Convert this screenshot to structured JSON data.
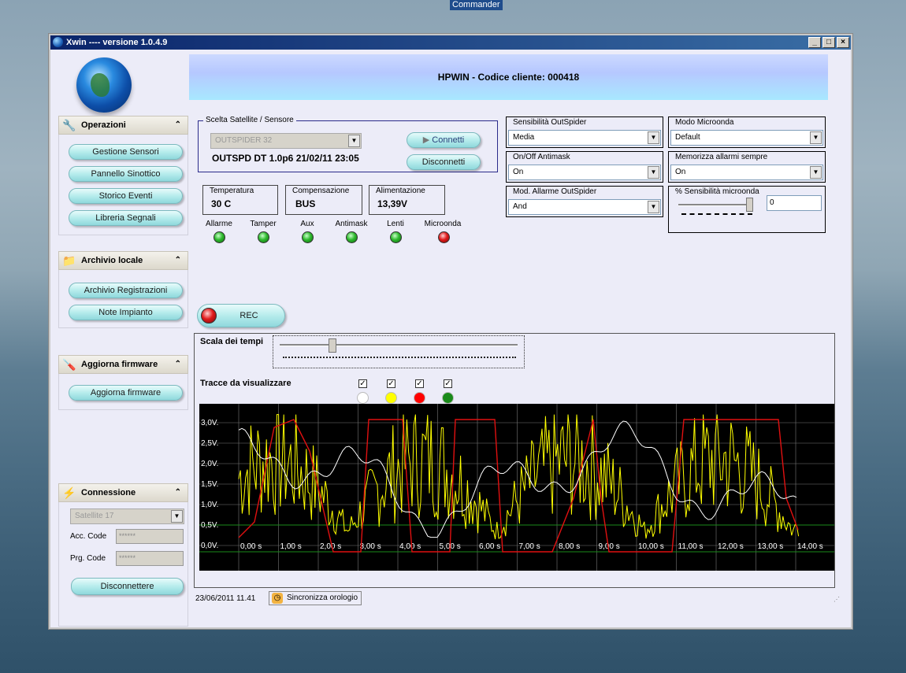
{
  "desktop": {
    "label": "Commander"
  },
  "window": {
    "title": "Xwin  ---- versione 1.0.4.9",
    "buttons": [
      "_",
      "□",
      "×"
    ]
  },
  "banner": {
    "text": "HPWIN -  Codice cliente: 000418"
  },
  "sidebar": {
    "operazioni": {
      "title": "Operazioni",
      "items": [
        "Gestione Sensori",
        "Pannello  Sinottico",
        "Storico Eventi",
        "Libreria Segnali"
      ]
    },
    "archivio": {
      "title": "Archivio locale",
      "items": [
        "Archivio Registrazioni",
        "Note Impianto"
      ]
    },
    "firmware": {
      "title": "Aggiorna firmware",
      "items": [
        "Aggiorna firmware"
      ]
    },
    "connessione": {
      "title": "Connessione",
      "satellite": "Satellite 17",
      "acc_label": "Acc. Code",
      "acc_value": "******",
      "prg_label": "Prg. Code",
      "prg_value": "******",
      "button": "Disconnettere"
    }
  },
  "satellite": {
    "group_title": "Scelta Satellite / Sensore",
    "selected": "OUTSPIDER 32",
    "info": "OUTSPD DT 1.0p6 21/02/11 23:05",
    "connect": "Connetti",
    "disconnect": "Disconnetti"
  },
  "readings": [
    {
      "label": "Temperatura",
      "value": "30 C"
    },
    {
      "label": "Compensazione",
      "value": "BUS"
    },
    {
      "label": "Alimentazione",
      "value": "13,39V"
    }
  ],
  "leds": [
    {
      "label": "Allarme",
      "state": "green"
    },
    {
      "label": "Tamper",
      "state": "green"
    },
    {
      "label": "Aux",
      "state": "green"
    },
    {
      "label": "Antimask",
      "state": "green"
    },
    {
      "label": "Lenti",
      "state": "green"
    },
    {
      "label": "Microonda",
      "state": "red"
    }
  ],
  "settings": {
    "sens_outspider": {
      "label": "Sensibilità OutSpider",
      "value": "Media"
    },
    "antimask": {
      "label": "On/Off Antimask",
      "value": "On"
    },
    "mod_allarme": {
      "label": "Mod. Allarme OutSpider",
      "value": "And"
    },
    "modo_microonda": {
      "label": "Modo Microonda",
      "value": "Default"
    },
    "memorizza": {
      "label": "Memorizza allarmi sempre",
      "value": "On"
    },
    "perc_microonda": {
      "label": "% Sensibilità microonda",
      "value": "0"
    }
  },
  "rec": {
    "label": "REC"
  },
  "graph": {
    "scala_label": "Scala dei tempi",
    "tracce_label": "Tracce da visualizzare",
    "traces": [
      {
        "color": "#ffffff",
        "checked": "✓"
      },
      {
        "color": "#ffff00",
        "checked": "✓"
      },
      {
        "color": "#ff0000",
        "checked": "✓"
      },
      {
        "color": "#1a8a1a",
        "checked": "✓"
      }
    ],
    "y_labels": [
      "3,0V.",
      "2,5V.",
      "2,0V.",
      "1,5V.",
      "1,0V.",
      "0,5V.",
      "0,0V."
    ],
    "x_labels": [
      "0,00 s",
      "1,00 s",
      "2,00 s",
      "3,00 s",
      "4,00 s",
      "5,00 s",
      "6,00 s",
      "7,00 s",
      "8,00 s",
      "9,00 s",
      "10,00 s",
      "11,00 s",
      "12,00 s",
      "13,00 s",
      "14,00 s"
    ]
  },
  "status": {
    "datetime": "23/06/2011 11.41",
    "sync_label": "Sincronizza orologio"
  }
}
